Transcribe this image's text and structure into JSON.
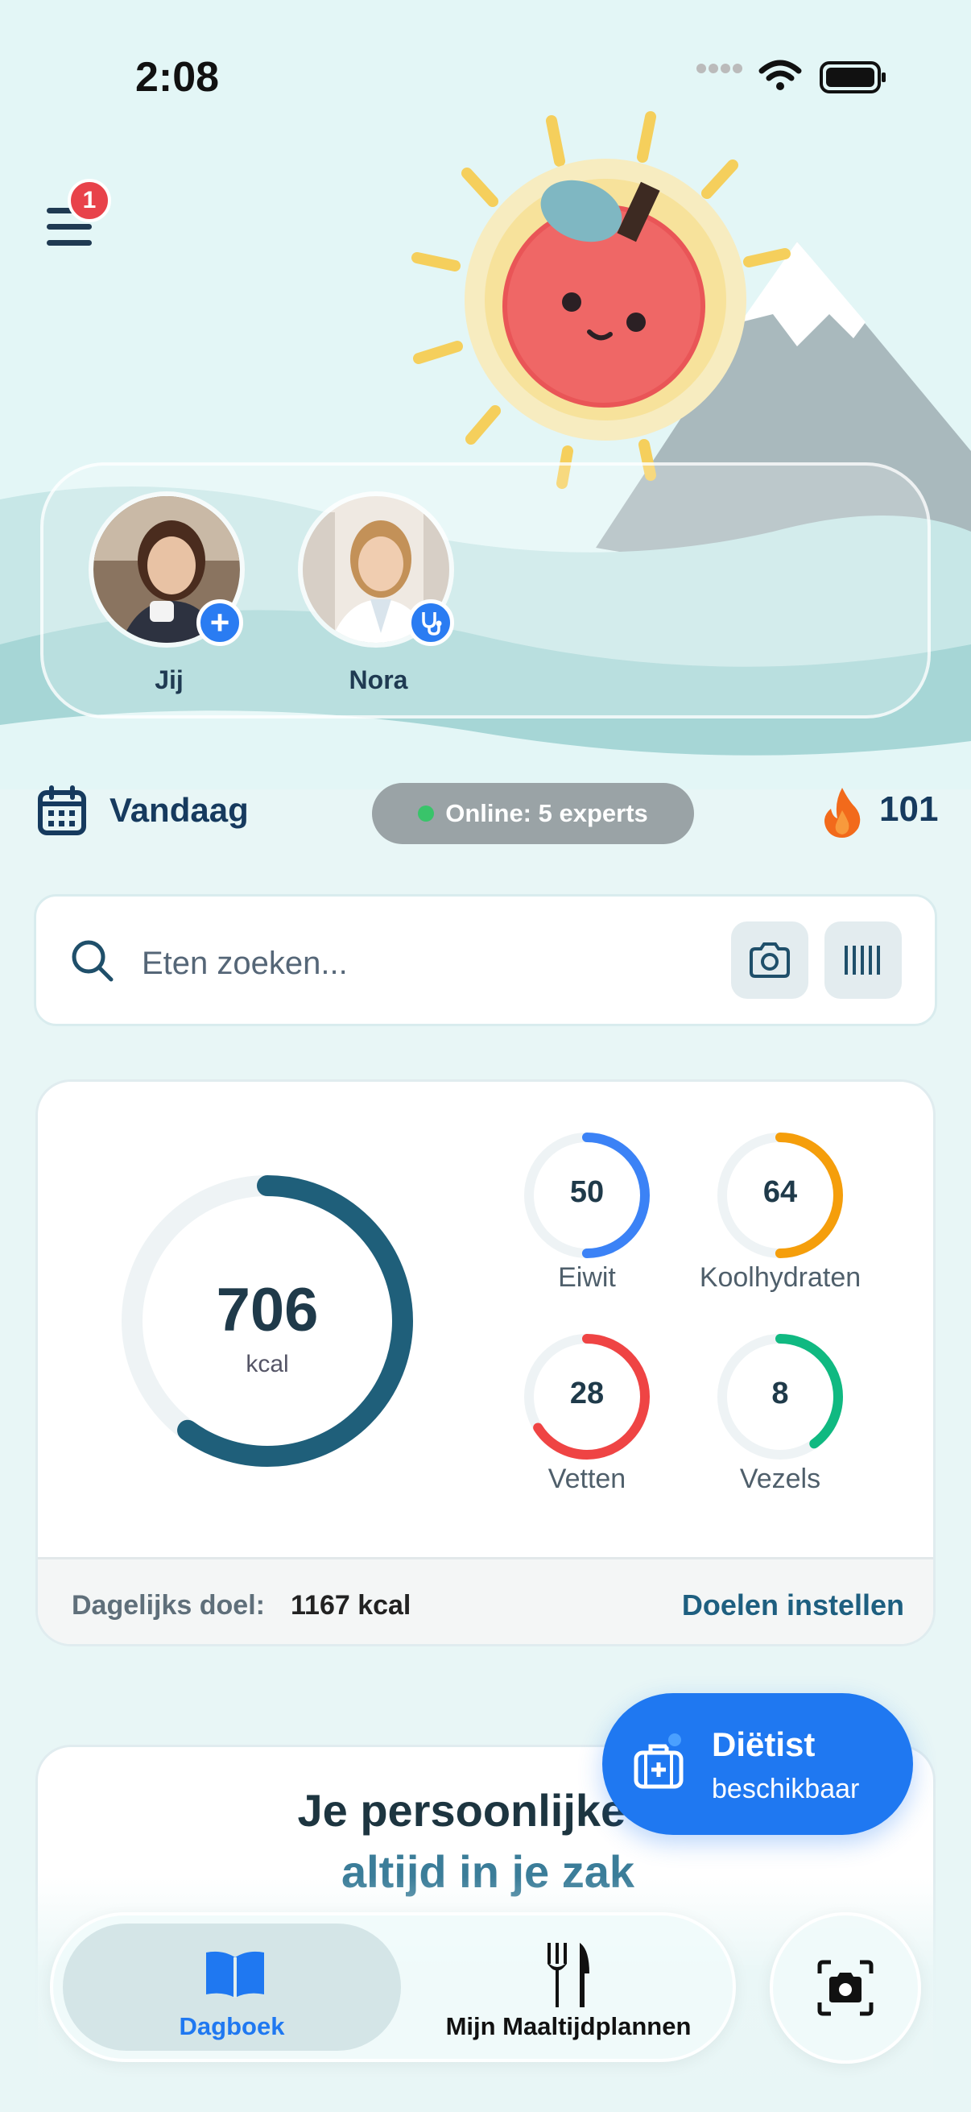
{
  "status_bar": {
    "time": "2:08"
  },
  "menu": {
    "badge_count": "1"
  },
  "profiles": [
    {
      "name": "Jij",
      "action": "+"
    },
    {
      "name": "Nora"
    }
  ],
  "date_bar": {
    "label": "Vandaag",
    "online_text": "Online: 5 experts",
    "streak": "101"
  },
  "search": {
    "placeholder": "Eten zoeken..."
  },
  "nutrition": {
    "calories": "706",
    "calories_unit": "kcal",
    "calories_progress": 0.6,
    "macros": [
      {
        "value": "50",
        "label": "Eiwit",
        "color": "#3b82f6",
        "progress": 0.5
      },
      {
        "value": "64",
        "label": "Koolhydraten",
        "color": "#f59e0b",
        "progress": 0.5
      },
      {
        "value": "28",
        "label": "Vetten",
        "color": "#ef4444",
        "progress": 0.66
      },
      {
        "value": "8",
        "label": "Vezels",
        "color": "#10b981",
        "progress": 0.4
      }
    ],
    "goal_label": "Dagelijks doel:",
    "goal_value": "1167 kcal",
    "goal_link": "Doelen instellen"
  },
  "promo": {
    "title_line1": "Je persoonlijke di",
    "title_line2": "altijd in je zak"
  },
  "fab": {
    "title": "Diëtist",
    "subtitle": "beschikbaar"
  },
  "tabbar": {
    "tab1": "Dagboek",
    "tab2": "Mijn Maaltijdplannen"
  },
  "colors": {
    "primary": "#1f78f1",
    "dark": "#163a5e",
    "ring": "#1f5f7a",
    "background": "#e8f6f6"
  }
}
